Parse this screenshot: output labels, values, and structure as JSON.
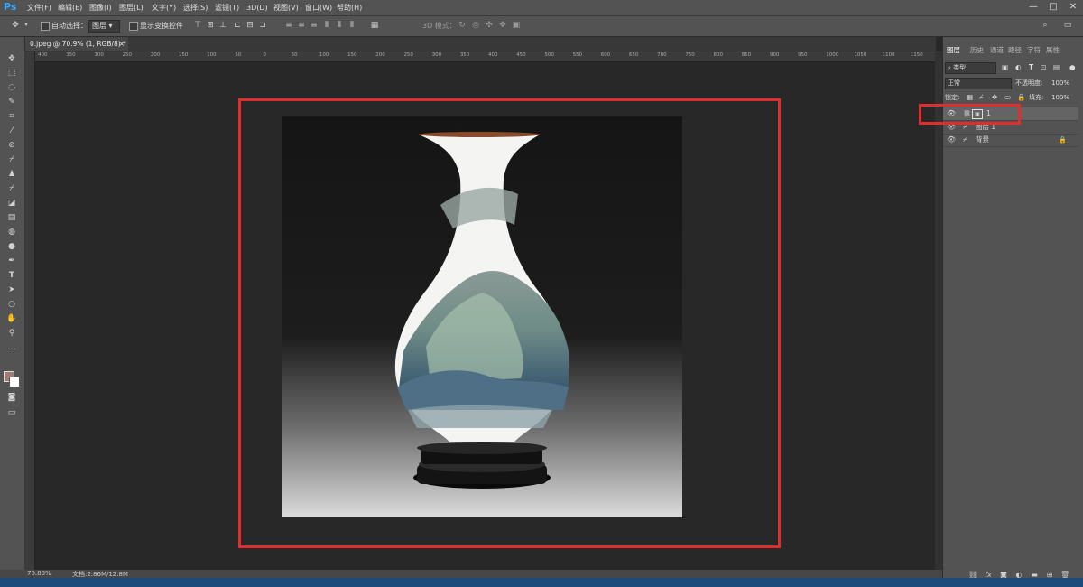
{
  "app": {
    "logo": "Ps"
  },
  "menu": [
    "文件(F)",
    "编辑(E)",
    "图像(I)",
    "图层(L)",
    "文字(Y)",
    "选择(S)",
    "滤镜(T)",
    "3D(D)",
    "视图(V)",
    "窗口(W)",
    "帮助(H)"
  ],
  "window_controls": {
    "minimize": "—",
    "maximize": "□",
    "close": "✕"
  },
  "options": {
    "auto_select_label": "自动选择：",
    "auto_select_value": "图层",
    "show_transform_label": "显示变换控件",
    "mode_3d_label": "3D 模式："
  },
  "document": {
    "tab_title": "0.jpeg @ 70.9% (1, RGB/8) *",
    "zoom": "70.89%",
    "doc_size": "文档:2.86M/12.8M"
  },
  "ruler": {
    "h_ticks": [
      "400",
      "350",
      "300",
      "250",
      "200",
      "150",
      "100",
      "50",
      "0",
      "50",
      "100",
      "150",
      "200",
      "250",
      "300",
      "350",
      "400",
      "450",
      "500",
      "550",
      "600",
      "650",
      "700",
      "750",
      "800",
      "850",
      "900",
      "950",
      "1000",
      "1050",
      "1100",
      "1150"
    ]
  },
  "panel": {
    "tabs": [
      "图层",
      "历史",
      "通道",
      "路径",
      "字符",
      "属性"
    ],
    "filter_label": "类型",
    "blend_mode": "正常",
    "opacity_label": "不透明度:",
    "opacity_value": "100%",
    "lock_label": "锁定:",
    "fill_label": "填充:",
    "fill_value": "100%",
    "layers": [
      {
        "name": "1"
      },
      {
        "name": "图层 1"
      },
      {
        "name": "背景"
      }
    ]
  },
  "colors": {
    "highlight": "#e02e2e",
    "ps_blue": "#31a8ff"
  }
}
